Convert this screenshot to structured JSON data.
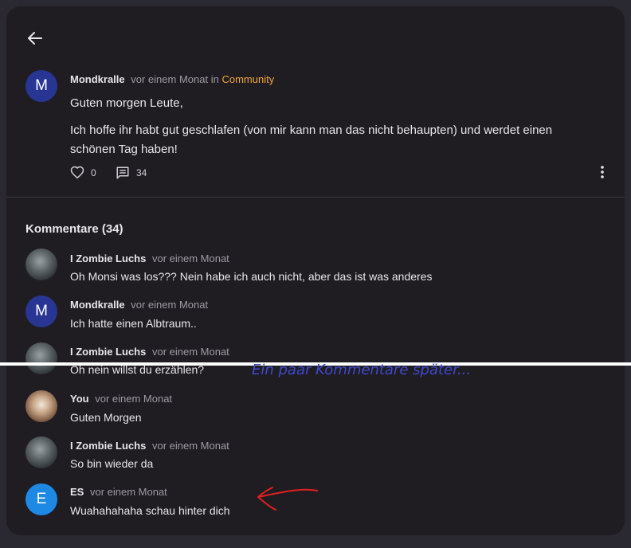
{
  "post": {
    "author_initial": "M",
    "author": "Mondkralle",
    "time": "vor einem Monat",
    "in_word": "in",
    "community": "Community",
    "line1": "Guten morgen Leute,",
    "line2": "Ich hoffe ihr habt gut geschlafen (von mir kann man das nicht behaupten) und werdet einen schönen Tag haben!",
    "likes": "0",
    "comments": "34"
  },
  "comments_title": "Kommentare (34)",
  "comments": [
    {
      "author": "I Zombie Luchs",
      "time": "vor einem Monat",
      "text": "Oh Monsi was los??? Nein habe ich auch nicht, aber das ist was anderes",
      "avatar": "lynx-photo"
    },
    {
      "author": "Mondkralle",
      "time": "vor einem Monat",
      "text": "Ich hatte einen Albtraum..",
      "initial": "M"
    },
    {
      "author": "I Zombie Luchs",
      "time": "vor einem Monat",
      "text": "Oh nein willst du erzählen?",
      "avatar": "lynx-photo"
    },
    {
      "author": "You",
      "time": "vor einem Monat",
      "text": "Guten Morgen",
      "avatar": "cat-photo"
    },
    {
      "author": "I Zombie Luchs",
      "time": "vor einem Monat",
      "text": "So bin wieder da",
      "avatar": "lynx-photo"
    },
    {
      "author": "ES",
      "time": "vor einem Monat",
      "text": "Wuahahahaha schau hinter dich",
      "initial": "E"
    }
  ],
  "overlay_caption": "Ein paar Kommentare später...",
  "colors": {
    "background": "#1f1d22",
    "community": "#f0a640",
    "overlay_text": "#3f48cc",
    "arrow": "#e02020",
    "avatar_m": "#283593",
    "avatar_e": "#1e88e5"
  },
  "icons": [
    "arrow-left-icon",
    "heart-icon",
    "comment-icon",
    "more-vertical-icon"
  ]
}
